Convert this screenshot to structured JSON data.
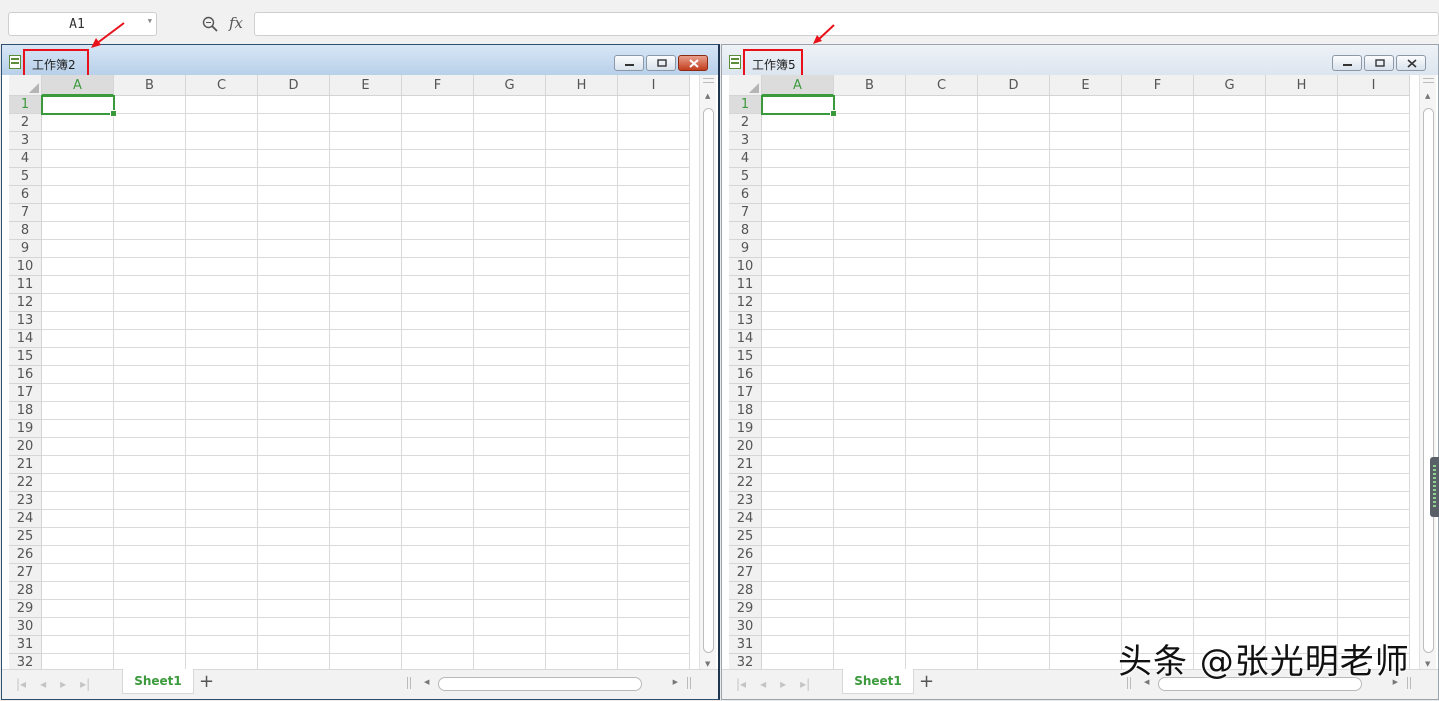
{
  "formula_bar": {
    "name_box": "A1",
    "zoom_icon": "magnifier-icon",
    "fx_label": "fx",
    "formula_value": ""
  },
  "columns": [
    "A",
    "B",
    "C",
    "D",
    "E",
    "F",
    "G",
    "H",
    "I"
  ],
  "rows": [
    "1",
    "2",
    "3",
    "4",
    "5",
    "6",
    "7",
    "8",
    "9",
    "10",
    "11",
    "12",
    "13",
    "14",
    "15",
    "16",
    "17",
    "18",
    "19",
    "20",
    "21",
    "22",
    "23",
    "24",
    "25",
    "26",
    "27",
    "28",
    "29",
    "30",
    "31",
    "32"
  ],
  "workbooks": [
    {
      "title": "工作簿2",
      "active": true,
      "sheet_tab": "Sheet1",
      "add_sheet": "+",
      "selected_cell": "A1"
    },
    {
      "title": "工作簿5",
      "active": false,
      "sheet_tab": "Sheet1",
      "add_sheet": "+",
      "selected_cell": "A1"
    }
  ],
  "sheet_nav": [
    "|◂",
    "◂",
    "▸",
    "▸|"
  ],
  "watermark": "头条 @张光明老师",
  "colors": {
    "accent_green": "#3a9a3a",
    "highlight_red": "#e8111a",
    "active_title": "#b9d0e9"
  }
}
